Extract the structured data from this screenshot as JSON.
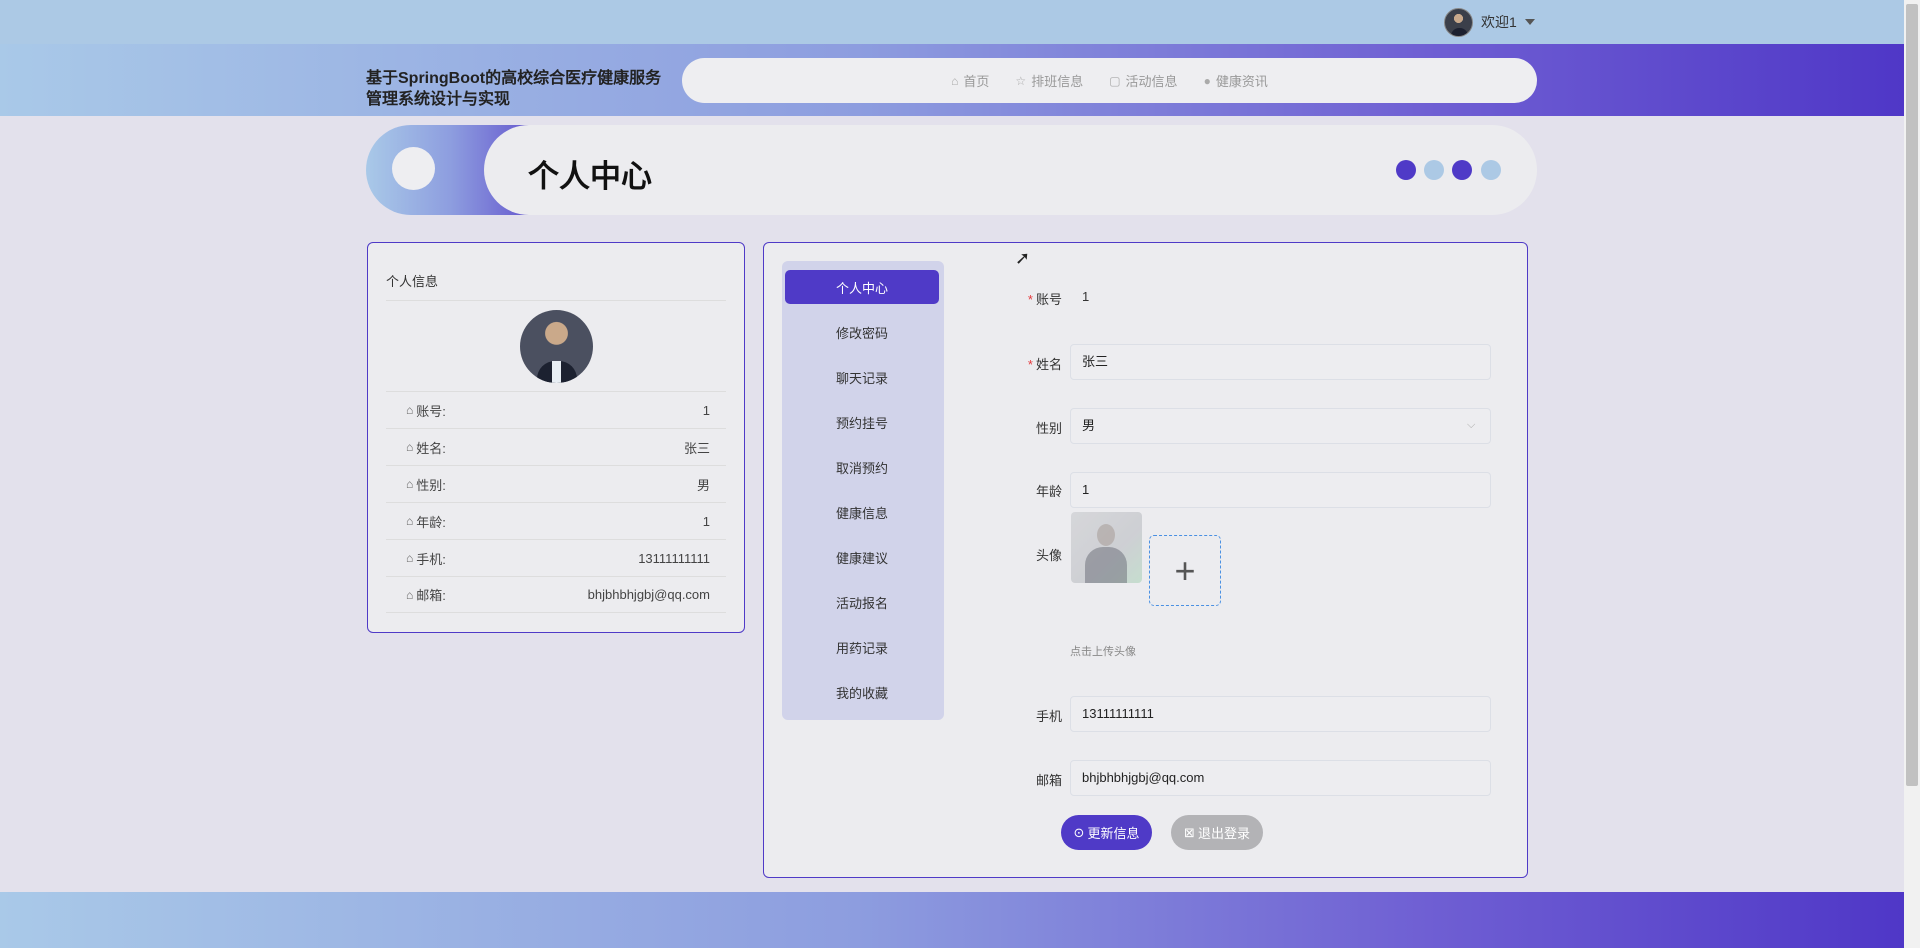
{
  "topbar": {
    "welcome": "欢迎1"
  },
  "header": {
    "site_title": "基于SpringBoot的高校综合医疗健康服务管理系统设计与实现",
    "nav": [
      {
        "label": "首页",
        "icon": "home-icon"
      },
      {
        "label": "排班信息",
        "icon": "star-icon"
      },
      {
        "label": "活动信息",
        "icon": "lock-icon"
      },
      {
        "label": "健康资讯",
        "icon": "info-icon"
      }
    ]
  },
  "banner": {
    "title": "个人中心",
    "dot_colors": [
      "#4f3ac7",
      "#acc9e5",
      "#4f3ac7",
      "#acc9e5"
    ]
  },
  "info_card": {
    "title": "个人信息",
    "rows": [
      {
        "label": "账号:",
        "value": "1"
      },
      {
        "label": "姓名:",
        "value": "张三"
      },
      {
        "label": "性别:",
        "value": "男"
      },
      {
        "label": "年龄:",
        "value": "1"
      },
      {
        "label": "手机:",
        "value": "13111111111"
      },
      {
        "label": "邮箱:",
        "value": "bhjbhbhjgbj@qq.com"
      }
    ]
  },
  "side_menu": [
    "个人中心",
    "修改密码",
    "聊天记录",
    "预约挂号",
    "取消预约",
    "健康信息",
    "健康建议",
    "活动报名",
    "用药记录",
    "我的收藏"
  ],
  "side_menu_active": 0,
  "form": {
    "account_label": "账号",
    "account_value": "1",
    "name_label": "姓名",
    "name_value": "张三",
    "gender_label": "性别",
    "gender_value": "男",
    "age_label": "年龄",
    "age_value": "1",
    "avatar_label": "头像",
    "upload_hint": "点击上传头像",
    "phone_label": "手机",
    "phone_value": "13111111111",
    "email_label": "邮箱",
    "email_value": "bhjbhbhjgbj@qq.com",
    "update_button": "更新信息",
    "logout_button": "退出登录"
  },
  "colors": {
    "accent": "#4f3ac7",
    "light_blue": "#acc9e5",
    "required": "#e4393c"
  }
}
